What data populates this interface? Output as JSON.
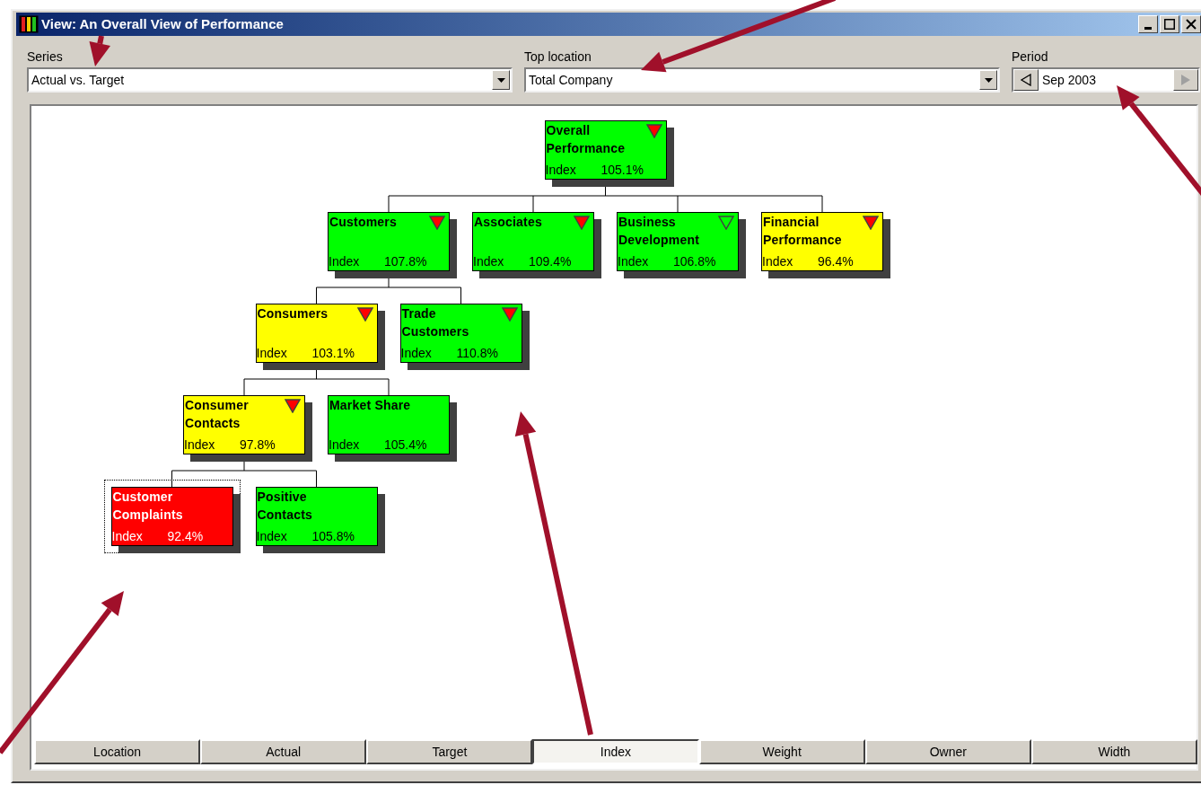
{
  "window": {
    "title": "View: An Overall View of Performance"
  },
  "series": {
    "label": "Series",
    "value": "Actual vs. Target"
  },
  "top_location": {
    "label": "Top location",
    "value": "Total Company"
  },
  "period": {
    "label": "Period",
    "value": "Sep 2003"
  },
  "tree": {
    "title": "Overall Performance",
    "measure": "Index",
    "value": "105.1%",
    "color": "#00ff00",
    "kind": "filled-flag",
    "selected": false,
    "children": [
      {
        "title": "Customers",
        "measure": "Index",
        "value": "107.8%",
        "color": "#00ff00",
        "kind": "filled-flag",
        "selected": false,
        "children": [
          {
            "title": "Consumers",
            "measure": "Index",
            "value": "103.1%",
            "color": "#ffff00",
            "kind": "filled-flag",
            "selected": false,
            "children": [
              {
                "title": "Consumer Contacts",
                "measure": "Index",
                "value": "97.8%",
                "color": "#ffff00",
                "kind": "filled-flag",
                "selected": false,
                "children": [
                  {
                    "title": "Customer Complaints",
                    "measure": "Index",
                    "value": "92.4%",
                    "color": "#ff0000",
                    "selected": true
                  },
                  {
                    "title": "Positive Contacts",
                    "measure": "Index",
                    "value": "105.8%",
                    "color": "#00ff00",
                    "selected": false
                  }
                ]
              },
              {
                "title": "Market Share",
                "measure": "Index",
                "value": "105.4%",
                "color": "#00ff00",
                "selected": false
              }
            ]
          },
          {
            "title": "Trade Customers",
            "measure": "Index",
            "value": "110.8%",
            "color": "#00ff00",
            "kind": "filled-flag",
            "selected": false
          }
        ]
      },
      {
        "title": "Associates",
        "measure": "Index",
        "value": "109.4%",
        "color": "#00ff00",
        "kind": "filled-flag",
        "selected": false
      },
      {
        "title": "Business Development",
        "measure": "Index",
        "value": "106.8%",
        "color": "#00ff00",
        "kind": "hollow-flag",
        "selected": false
      },
      {
        "title": "Financial Performance",
        "measure": "Index",
        "value": "96.4%",
        "color": "#ffff00",
        "kind": "filled-flag",
        "selected": false
      }
    ]
  },
  "columns": [
    {
      "label": "Location",
      "selected": false
    },
    {
      "label": "Actual",
      "selected": false
    },
    {
      "label": "Target",
      "selected": false
    },
    {
      "label": "Index",
      "selected": true
    },
    {
      "label": "Weight",
      "selected": false
    },
    {
      "label": "Owner",
      "selected": false
    },
    {
      "label": "Width",
      "selected": false
    }
  ]
}
